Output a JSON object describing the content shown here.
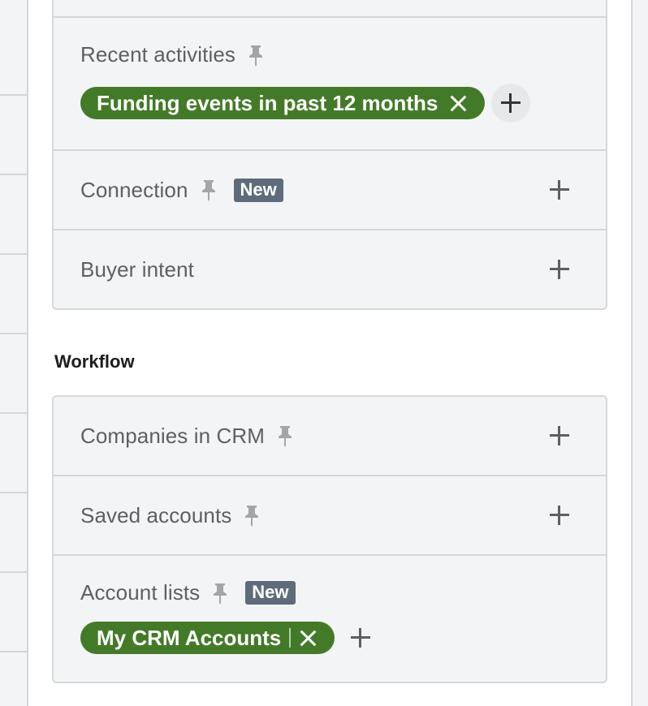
{
  "filters": {
    "top_card": {
      "rows": [
        {
          "label": "Recent activities",
          "pinned": true,
          "chips": [
            {
              "label": "Funding events in past 12 months",
              "remove_icon": "close-icon"
            }
          ],
          "add_icon": "plus-icon"
        },
        {
          "label": "Connection",
          "pinned": true,
          "badge": "New",
          "add_icon": "plus-icon"
        },
        {
          "label": "Buyer intent",
          "pinned": false,
          "add_icon": "plus-icon"
        }
      ]
    },
    "workflow": {
      "title": "Workflow",
      "rows": [
        {
          "label": "Companies in CRM",
          "pinned": true,
          "add_icon": "plus-icon"
        },
        {
          "label": "Saved accounts",
          "pinned": true,
          "add_icon": "plus-icon"
        },
        {
          "label": "Account lists",
          "pinned": true,
          "badge": "New",
          "chips": [
            {
              "label": "My CRM Accounts",
              "remove_icon": "close-icon"
            }
          ],
          "add_icon": "plus-icon"
        }
      ]
    }
  },
  "colors": {
    "chip_green": "#437a28",
    "badge_slate": "#5d6b7a",
    "panel_bg": "#f3f4f6",
    "border": "#d6d6d8"
  }
}
